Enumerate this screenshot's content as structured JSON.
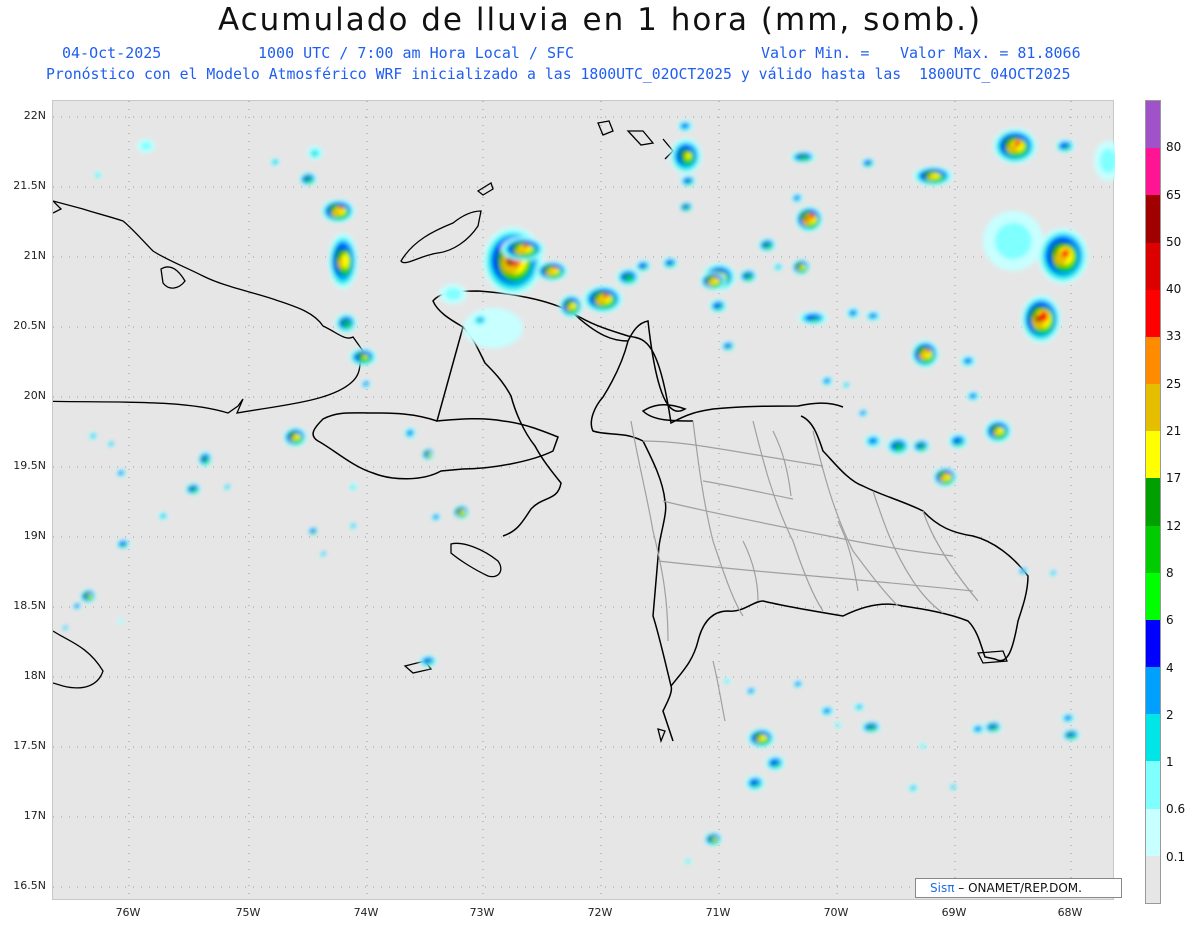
{
  "title": "Acumulado de lluvia en 1 hora (mm, somb.)",
  "subtitle": {
    "date": "04-Oct-2025",
    "time": "1000 UTC / 7:00 am Hora Local / SFC",
    "valor_min": "Valor Min. =",
    "valor_max": "Valor Max. = 81.8066",
    "model_line": "Pronóstico con el Modelo Atmosférico WRF inicializado a las 1800UTC_02OCT2025 y válido hasta las  1800UTC_04OCT2025"
  },
  "map": {
    "lon_range": [
      -77.7,
      -68.4
    ],
    "lat_range": [
      16.4,
      22.1
    ],
    "lat_labels": [
      "22N",
      "21.5N",
      "21N",
      "20.5N",
      "20N",
      "19.5N",
      "19N",
      "18.5N",
      "18N",
      "17.5N",
      "17N",
      "16.5N"
    ],
    "lon_labels": [
      "76W",
      "75W",
      "74W",
      "73W",
      "72W",
      "71W",
      "70W",
      "69W",
      "68W"
    ],
    "grid": true,
    "background_color": "#e6e6e6",
    "coast_color": "#000000",
    "province_border_color": "#9a9a9a"
  },
  "colorbar": {
    "levels": [
      "80",
      "65",
      "50",
      "40",
      "33",
      "25",
      "21",
      "17",
      "12",
      "8",
      "6",
      "4",
      "2",
      "1",
      "0.6",
      "0.1"
    ],
    "colors": [
      "#a052c8",
      "#ff1493",
      "#a00000",
      "#dc0000",
      "#ff0000",
      "#ff8c00",
      "#e6be00",
      "#ffff00",
      "#00a000",
      "#00cc00",
      "#00ff00",
      "#0000ff",
      "#00a0ff",
      "#00e6e6",
      "#80ffff",
      "#c8ffff",
      "#e6e6e6"
    ]
  },
  "credit": {
    "logo": "Sis",
    "logo_pi": "π",
    "text": "– ONAMET/REP.DOM."
  }
}
